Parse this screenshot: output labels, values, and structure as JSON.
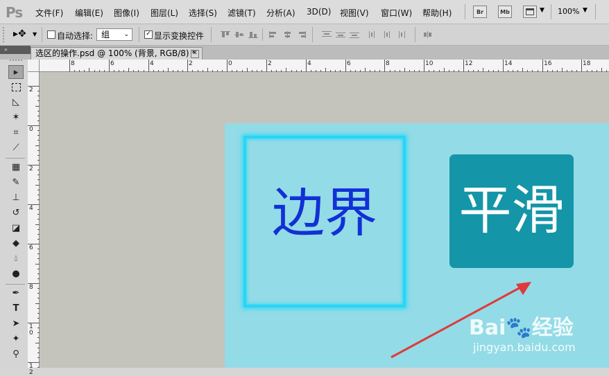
{
  "app": {
    "logo": "Ps",
    "zoom": "100%"
  },
  "menu": [
    "文件(F)",
    "编辑(E)",
    "图像(I)",
    "图层(L)",
    "选择(S)",
    "滤镜(T)",
    "分析(A)",
    "3D(D)",
    "视图(V)",
    "窗口(W)",
    "帮助(H)"
  ],
  "menu_buttons": {
    "bridge": "Br",
    "minibridge": "Mb"
  },
  "options": {
    "auto_select_label": "自动选择:",
    "auto_select_value": "组",
    "show_transform_label": "显示变换控件"
  },
  "document_tab": {
    "title": "选区的操作.psd @ 100% (背景, RGB/8) *",
    "close": "✕"
  },
  "ruler": {
    "h_labels": [
      "8",
      "6",
      "4",
      "2",
      "0",
      "2",
      "4",
      "6",
      "8",
      "10",
      "12",
      "14",
      "16",
      "18"
    ],
    "v_labels": [
      "2",
      "0",
      "2",
      "4",
      "6",
      "8",
      "1\n0",
      "1\n2"
    ]
  },
  "canvas": {
    "border_text": "边界",
    "smooth_text": "平滑"
  },
  "watermark": {
    "logo": "Bai🐾经验",
    "site": "jingyan.baidu.com"
  },
  "colors": {
    "doc_bg": "#93dbe6",
    "glow": "#2ad4f4",
    "border_text": "#1230d6",
    "smooth_bg": "#1495a8",
    "arrow": "#e0393a"
  }
}
